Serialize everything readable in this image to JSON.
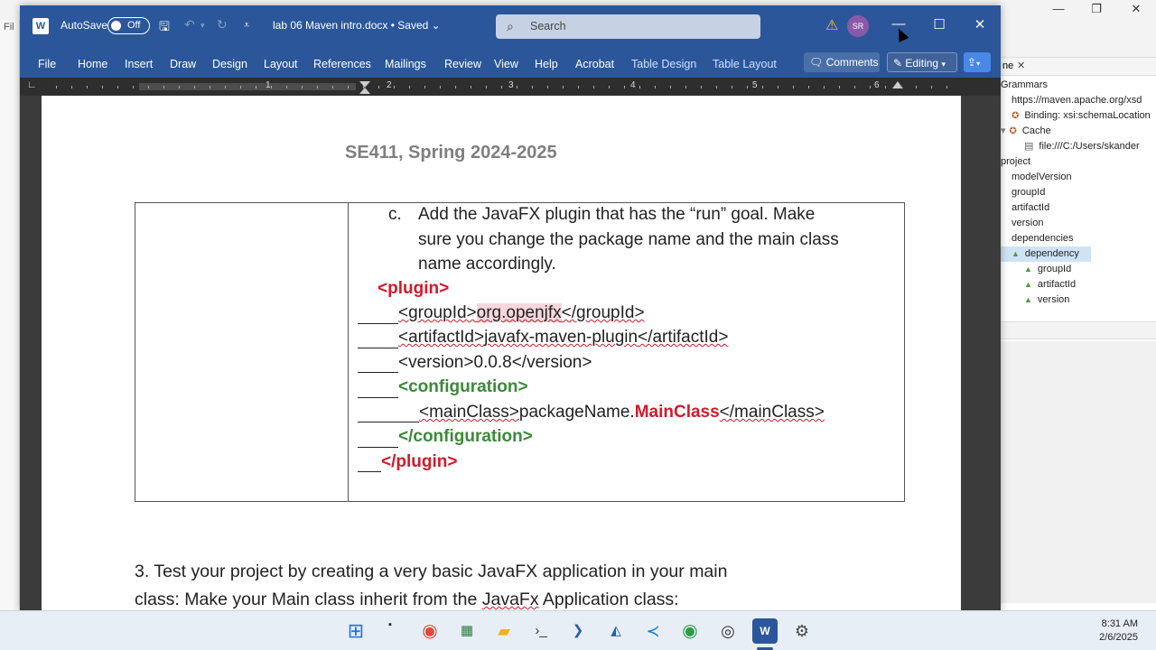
{
  "background_app": {
    "left_letters": [
      "Fil"
    ],
    "right_panel": {
      "tab_label": "ne",
      "tree": [
        {
          "label": "Grammars",
          "kind": "text"
        },
        {
          "label": "https://maven.apache.org/xsd",
          "kind": "text"
        },
        {
          "label": "Binding: xsi:schemaLocation",
          "kind": "dot"
        },
        {
          "label": "Cache",
          "kind": "dot"
        },
        {
          "label": "file:///C:/Users/skander",
          "kind": "file"
        },
        {
          "label": "project",
          "kind": "text"
        },
        {
          "label": "modelVersion",
          "kind": "text"
        },
        {
          "label": "groupId",
          "kind": "text"
        },
        {
          "label": "artifactId",
          "kind": "text"
        },
        {
          "label": "version",
          "kind": "text"
        },
        {
          "label": "dependencies",
          "kind": "text"
        },
        {
          "label": "dependency",
          "kind": "tri"
        },
        {
          "label": "groupId",
          "kind": "tri"
        },
        {
          "label": "artifactId",
          "kind": "tri"
        },
        {
          "label": "version",
          "kind": "tri"
        }
      ]
    }
  },
  "word": {
    "autosave_label": "AutoSave",
    "autosave_state": "Off",
    "doc_title": "lab 06 Maven intro.docx • Saved",
    "search_placeholder": "Search",
    "avatar_initials": "SR",
    "menu": [
      "File",
      "Home",
      "Insert",
      "Draw",
      "Design",
      "Layout",
      "References",
      "Mailings",
      "Review",
      "View",
      "Help",
      "Acrobat"
    ],
    "context_menu": [
      "Table Design",
      "Table Layout"
    ],
    "comments_label": "Comments",
    "editing_label": "Editing",
    "ruler_numbers": [
      "1",
      "2",
      "3",
      "4",
      "5",
      "6"
    ]
  },
  "document": {
    "header": "SE411, Spring 2024-2025",
    "step_marker": "c.",
    "step_lines": [
      "Add the JavaFX plugin that has the “run” goal. Make",
      "sure you change the package name and the main class",
      "name accordingly."
    ],
    "code": {
      "plugin_open": "<plugin>",
      "groupid_open": "<groupId>",
      "groupid_value": "org.openjfx",
      "groupid_close": "</groupId>",
      "artifact_open": "<artifactId>",
      "artifact_value": "javafx-maven-plugin",
      "artifact_close": "</artifactId>",
      "version_line": "<version>0.0.8</version>",
      "config_open": "<configuration>",
      "mainclass_open": "<mainClass>",
      "mainclass_pkg": "packageName.",
      "mainclass_name": "MainClass",
      "mainclass_close": "</mainClass>",
      "config_close": "</configuration>",
      "plugin_close": "</plugin>"
    },
    "para3_line1": "3. Test your project by creating a very basic JavaFX application in your main",
    "para3_line2_a": "class: Make your Main class inherit from the ",
    "para3_line2_b": "JavaFx",
    "para3_line2_c": " Application class:"
  },
  "taskbar": {
    "time": "8:31 AM",
    "date": "2/6/2025",
    "apps": [
      "windows-start",
      "task-view",
      "chrome",
      "calculator",
      "file-explorer",
      "terminal",
      "powershell",
      "azure-data-studio",
      "vscode",
      "chrome-2",
      "obs",
      "word",
      "settings"
    ]
  }
}
